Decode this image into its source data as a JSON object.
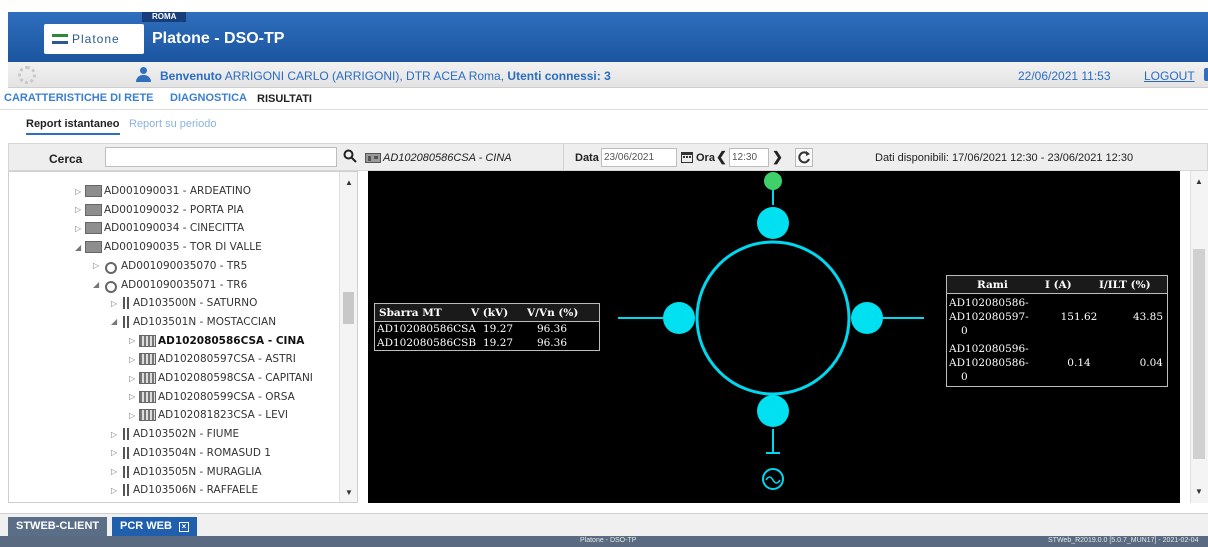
{
  "header": {
    "city_badge": "ROMA",
    "logo_text": "Platone",
    "title": "Platone - DSO-TP"
  },
  "userbar": {
    "welcome_prefix": "Benvenuto",
    "welcome_user": "ARRIGONI CARLO (ARRIGONI), DTR ACEA Roma,",
    "connected_label": "Utenti connessi: 3",
    "datetime": "22/06/2021 11:53",
    "logout_label": "LOGOUT"
  },
  "main_tabs": [
    "CARATTERISTICHE DI RETE",
    "DIAGNOSTICA",
    "RISULTATI"
  ],
  "sub_tabs": [
    "Report istantaneo",
    "Report su periodo"
  ],
  "toolbar": {
    "search_label": "Cerca",
    "search_value": "",
    "selected_name": "AD102080586CSA - CINA",
    "date_label": "Data",
    "date_value": "23/06/2021",
    "time_label": "Ora",
    "time_value": "12:30",
    "available": "Dati disponibili: 17/06/2021 12:30 - 23/06/2021 12:30"
  },
  "tree": [
    {
      "label": "AD001090031 - ARDEATINO",
      "icon": "cabin-icon",
      "level": 0,
      "state": "collapsed"
    },
    {
      "label": "AD001090032 - PORTA PIA",
      "icon": "cabin-icon",
      "level": 0,
      "state": "collapsed"
    },
    {
      "label": "AD001090034 - CINECITTA",
      "icon": "cabin-icon",
      "level": 0,
      "state": "collapsed"
    },
    {
      "label": "AD001090035 - TOR DI VALLE",
      "icon": "cabin-icon",
      "level": 0,
      "state": "expanded"
    },
    {
      "label": "AD001090035070 - TR5",
      "icon": "transformer-icon",
      "level": 1,
      "state": "collapsed"
    },
    {
      "label": "AD001090035071 - TR6",
      "icon": "transformer-icon",
      "level": 1,
      "state": "expanded"
    },
    {
      "label": "AD103500N - SATURNO",
      "icon": "line-icon",
      "level": 2,
      "state": "collapsed"
    },
    {
      "label": "AD103501N - MOSTACCIAN",
      "icon": "line-icon",
      "level": 2,
      "state": "expanded"
    },
    {
      "label": "AD102080586CSA - CINA",
      "icon": "substation-icon",
      "level": 3,
      "state": "collapsed",
      "selected": true
    },
    {
      "label": "AD102080597CSA - ASTRI",
      "icon": "substation-icon",
      "level": 3,
      "state": "collapsed"
    },
    {
      "label": "AD102080598CSA - CAPITANI",
      "icon": "substation-icon",
      "level": 3,
      "state": "collapsed"
    },
    {
      "label": "AD102080599CSA - ORSA",
      "icon": "substation-icon",
      "level": 3,
      "state": "collapsed"
    },
    {
      "label": "AD102081823CSA - LEVI",
      "icon": "substation-icon",
      "level": 3,
      "state": "collapsed"
    },
    {
      "label": "AD103502N - FIUME",
      "icon": "line-icon",
      "level": 2,
      "state": "collapsed"
    },
    {
      "label": "AD103504N - ROMASUD 1",
      "icon": "line-icon",
      "level": 2,
      "state": "collapsed"
    },
    {
      "label": "AD103505N - MURAGLIA",
      "icon": "line-icon",
      "level": 2,
      "state": "collapsed"
    },
    {
      "label": "AD103506N - RAFFAELE",
      "icon": "line-icon",
      "level": 2,
      "state": "collapsed"
    }
  ],
  "busbar_table": {
    "headers": [
      "Sbarra MT",
      "V (kV)",
      "V/Vn (%)"
    ],
    "rows": [
      [
        "AD102080586CSA",
        "19.27",
        "96.36"
      ],
      [
        "AD102080586CSB",
        "19.27",
        "96.36"
      ]
    ]
  },
  "branch_table": {
    "headers": [
      "Rami",
      "I (A)",
      "I/ILT (%)"
    ],
    "rows": [
      {
        "name_lines": [
          "AD102080586-",
          "AD102080597-",
          "0"
        ],
        "i": "151.62",
        "pct": "43.85"
      },
      {
        "name_lines": [
          "AD102080596-",
          "AD102080586-",
          "0"
        ],
        "i": "0.14",
        "pct": "0.04"
      }
    ]
  },
  "diagram_colors": {
    "node": "#00e0f0",
    "ring": "#00d8f0",
    "top_node": "#3fd06a",
    "background": "#000000"
  },
  "bottom_tabs": [
    "STWEB-CLIENT",
    "PCR WEB"
  ],
  "status": {
    "center": "Platone - DSO-TP",
    "right": "STWeb_R2019.0.0 [5.0.7_MUN17] - 2021-02-04"
  }
}
